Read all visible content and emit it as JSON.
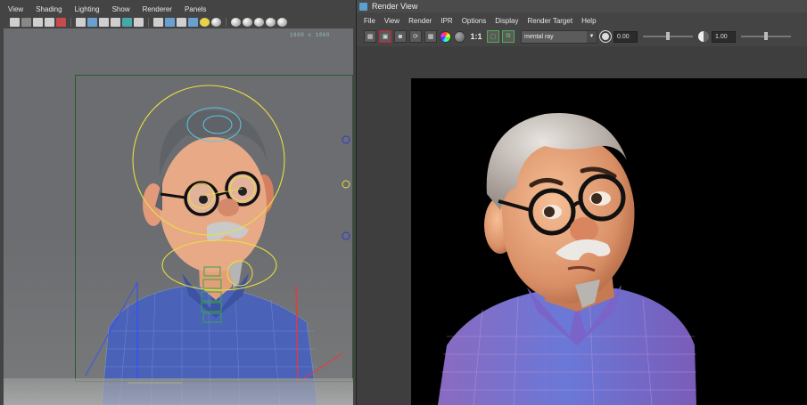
{
  "viewport": {
    "menu": [
      "View",
      "Shading",
      "Lighting",
      "Show",
      "Renderer",
      "Panels"
    ],
    "resolution_label": "1600 x 1060",
    "toolbar_icons": [
      "select-camera-icon",
      "camera-attr-icon",
      "bookmark-icon",
      "image-plane-icon",
      "grid-icon",
      "film-gate-icon",
      "resolution-gate-icon",
      "gate-mask-icon",
      "field-chart-icon",
      "safe-action-icon",
      "safe-title-icon",
      "wireframe-icon",
      "smooth-shade-icon",
      "default-light-icon",
      "all-lights-icon",
      "shadows-icon",
      "isolate-icon",
      "xray-icon",
      "xray-joints-icon",
      "backface-icon",
      "ambient-occlusion-icon"
    ]
  },
  "render_view": {
    "window_title": "Render View",
    "menu": [
      "File",
      "View",
      "Render",
      "IPR",
      "Options",
      "Display",
      "Render Target",
      "Help"
    ],
    "renderer": "mental ray",
    "exposure_value": "0.00",
    "gamma_value": "1.00",
    "ratio_label": "1:1",
    "exposure_fraction": 0.5,
    "gamma_fraction": 0.5
  },
  "colors": {
    "bg_panel": "#444444",
    "viewport_bg": "#6b6d70",
    "render_bg": "#000000",
    "shirt_blue": "#4a66c8",
    "selection_yellow": "#e8e040",
    "selection_cyan": "#5ac8e0"
  }
}
